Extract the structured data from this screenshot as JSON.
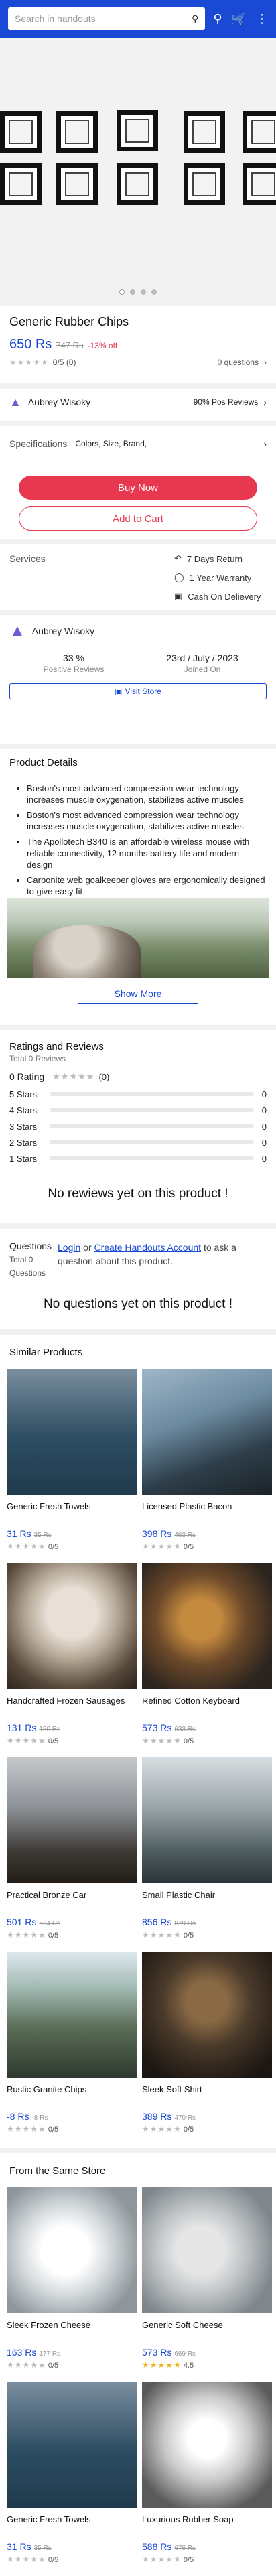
{
  "search": {
    "placeholder": "Search in handouts"
  },
  "product": {
    "name": "Generic Rubber Chips",
    "price": "650 Rs",
    "old_price": "747 Rs",
    "discount": "-13% off",
    "rating_text": "0/5 (0)",
    "questions": "0 questions"
  },
  "seller_short": {
    "name": "Aubrey Wisoky",
    "positive": "90% Pos Reviews"
  },
  "specs": {
    "label": "Specifications",
    "value": "Colors, Size, Brand,"
  },
  "buttons": {
    "buy": "Buy Now",
    "cart": "Add to Cart"
  },
  "services": {
    "label": "Services",
    "items": [
      "7 Days Return",
      "1 Year Warranty",
      "Cash On Delievery"
    ]
  },
  "store": {
    "name": "Aubrey Wisoky",
    "positive_value": "33 %",
    "positive_label": "Positive Reviews",
    "joined_value": "23rd / July / 2023",
    "joined_label": "Joined On",
    "visit": "Visit Store"
  },
  "details": {
    "title": "Product Details",
    "features": [
      "Boston's most advanced compression wear technology increases muscle oxygenation, stabilizes active muscles",
      "Boston's most advanced compression wear technology increases muscle oxygenation, stabilizes active muscles",
      "The Apollotech B340 is an affordable wireless mouse with reliable connectivity, 12 months battery life and modern design",
      "Carbonite web goalkeeper gloves are ergonomically designed to give easy fit"
    ],
    "show_more": "Show More"
  },
  "reviews": {
    "title": "Ratings and Reviews",
    "total": "Total 0 Reviews",
    "rating": "0 Rating",
    "rating_count": "(0)",
    "rows": [
      {
        "label": "5 Stars",
        "count": "0"
      },
      {
        "label": "4 Stars",
        "count": "0"
      },
      {
        "label": "3 Stars",
        "count": "0"
      },
      {
        "label": "2 Stars",
        "count": "0"
      },
      {
        "label": "1 Stars",
        "count": "0"
      }
    ],
    "empty": "No rewiews yet on this product !"
  },
  "questions": {
    "title": "Questions",
    "total": "Total 0 Questions",
    "prompt_or": "or",
    "login": "Login",
    "create": "Create Handouts Account",
    "prompt_rest": "to ask a question about this product.",
    "empty": "No questions yet on this product !"
  },
  "similar": {
    "title": "Similar Products",
    "items": [
      {
        "name": "Generic Fresh Towels",
        "price": "31 Rs",
        "old": "35 Rs",
        "rating": "0/5"
      },
      {
        "name": "Licensed Plastic Bacon",
        "price": "398 Rs",
        "old": "463 Rs",
        "rating": "0/5"
      },
      {
        "name": "Handcrafted Frozen Sausages",
        "price": "131 Rs",
        "old": "150 Rs",
        "rating": "0/5"
      },
      {
        "name": "Refined Cotton Keyboard",
        "price": "573 Rs",
        "old": "633 Rs",
        "rating": "0/5"
      },
      {
        "name": "Practical Bronze Car",
        "price": "501 Rs",
        "old": "524 Rs",
        "rating": "0/5"
      },
      {
        "name": "Small Plastic Chair",
        "price": "856 Rs",
        "old": "879 Rs",
        "rating": "0/5"
      },
      {
        "name": "Rustic Granite Chips",
        "price": "-8 Rs",
        "old": "-8 Rs",
        "rating": "0/5"
      },
      {
        "name": "Sleek Soft Shirt",
        "price": "389 Rs",
        "old": "470 Rs",
        "rating": "0/5"
      }
    ]
  },
  "same_store": {
    "title": "From the Same Store",
    "items": [
      {
        "name": "Sleek Frozen Cheese",
        "price": "163 Rs",
        "old": "177 Rs",
        "rating": "0/5"
      },
      {
        "name": "Generic Soft Cheese",
        "price": "573 Rs",
        "old": "669 Rs",
        "rating": "4.5"
      },
      {
        "name": "Generic Fresh Towels",
        "price": "31 Rs",
        "old": "35 Rs",
        "rating": "0/5"
      },
      {
        "name": "Luxurious Rubber Soap",
        "price": "588 Rs",
        "old": "676 Rs",
        "rating": "0/5"
      }
    ]
  },
  "colors": {
    "brand": "#1a49d6",
    "accent": "#e8384f"
  }
}
